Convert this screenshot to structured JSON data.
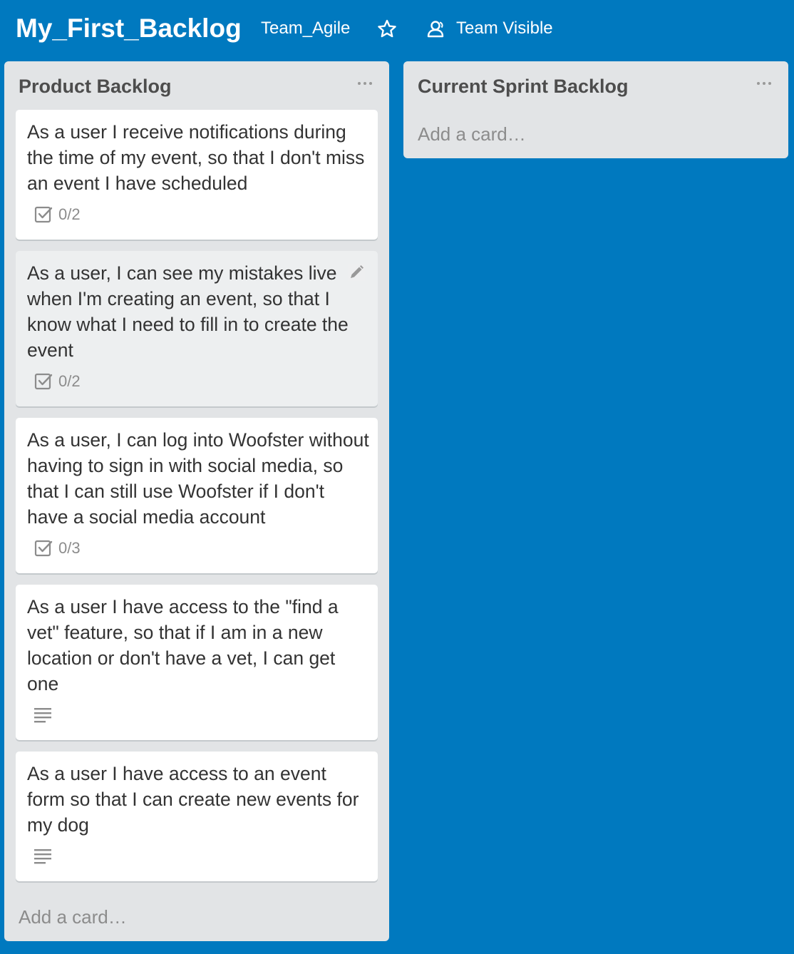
{
  "board": {
    "title": "My_First_Backlog",
    "team": "Team_Agile",
    "visibility": "Team Visible",
    "star_icon": "star-outline-icon",
    "visibility_icon": "team-people-icon"
  },
  "lists": [
    {
      "title": "Product Backlog",
      "add_card": "Add a card…",
      "cards": [
        {
          "text": "As a user I receive notifications during the time of my event, so that I don't miss an event I have scheduled",
          "checklist": "0/2"
        },
        {
          "text": "As a user, I can see my mistakes live when I'm creating an event, so that I know what I need to fill in to create the event",
          "checklist": "0/2"
        },
        {
          "text": "As a user, I can log into Woofster without having to sign in with social media, so that I can still use Woofster if I don't have a social media account",
          "checklist": "0/3"
        },
        {
          "text": "As a user I have access to the \"find a vet\" feature, so that if I am in a new location or don't have a vet, I can get one",
          "has_description": true
        },
        {
          "text": "As a user I have access to an event form so that I can create new events for my dog",
          "has_description": true
        }
      ]
    },
    {
      "title": "Current Sprint Backlog",
      "add_card": "Add a card…",
      "cards": []
    }
  ],
  "colors": {
    "board_background": "#0079bf",
    "list_background": "#e2e4e6",
    "card_background": "#ffffff",
    "card_hover_background": "#edeff0",
    "muted_text": "#8c8c8c"
  }
}
